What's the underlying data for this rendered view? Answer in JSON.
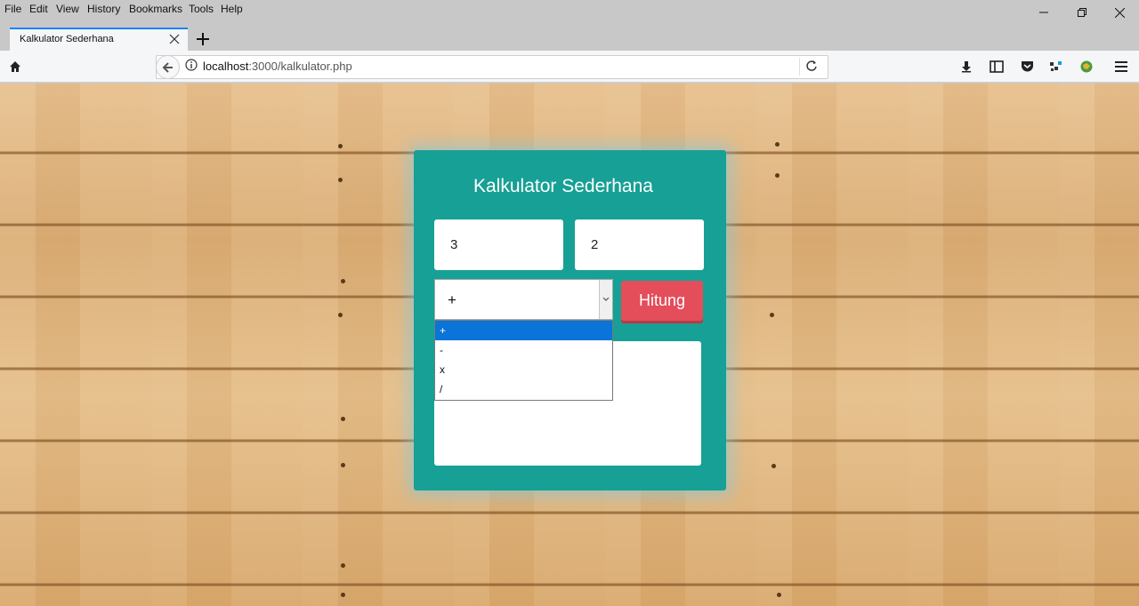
{
  "menubar": {
    "items": [
      "File",
      "Edit",
      "View",
      "History",
      "Bookmarks",
      "Tools",
      "Help"
    ]
  },
  "tab": {
    "title": "Kalkulator Sederhana"
  },
  "urlbar": {
    "host": "localhost",
    "path": ":3000/kalkulator.php"
  },
  "calculator": {
    "title": "Kalkulator Sederhana",
    "input1": "3",
    "input2": "2",
    "operator_selected": "+",
    "operator_options": [
      "+",
      "-",
      "x",
      "/"
    ],
    "submit_label": "Hitung",
    "result": ""
  },
  "colors": {
    "panel": "#17a095",
    "button": "#e44d5a",
    "selected_option": "#0a74d8"
  },
  "icons": [
    "home-icon",
    "back-arrow-icon",
    "info-icon",
    "reload-icon",
    "download-icon",
    "sidebar-icon",
    "pocket-icon",
    "extension-icon",
    "globe-extension-icon",
    "hamburger-menu-icon",
    "close-icon",
    "plus-icon",
    "minimize-icon",
    "restore-icon"
  ]
}
